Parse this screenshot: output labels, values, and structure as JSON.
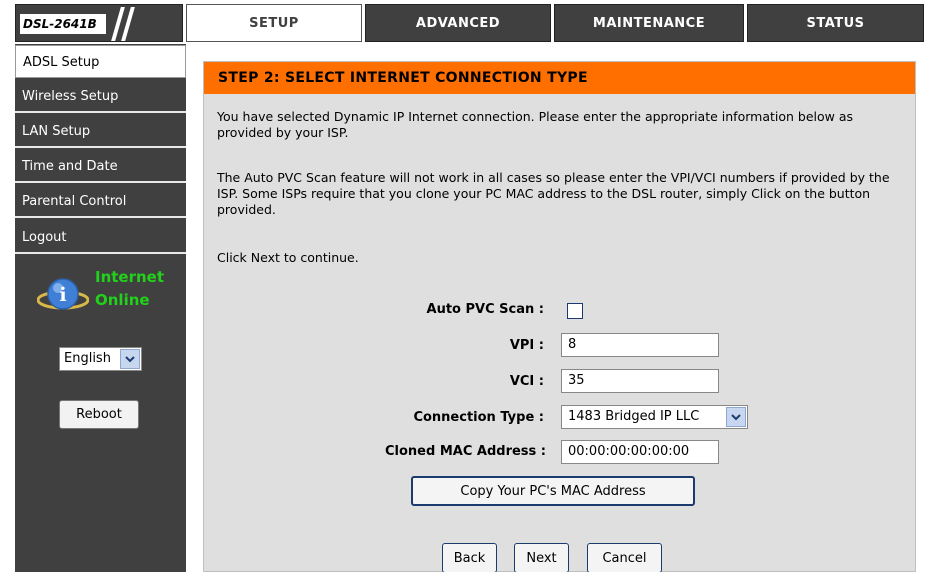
{
  "header": {
    "model": "DSL-2641B",
    "tabs": [
      {
        "label": "SETUP",
        "active": true
      },
      {
        "label": "ADVANCED",
        "active": false
      },
      {
        "label": "MAINTENANCE",
        "active": false
      },
      {
        "label": "STATUS",
        "active": false
      }
    ]
  },
  "sidebar": {
    "items": [
      {
        "label": "ADSL Setup",
        "active": true
      },
      {
        "label": "Wireless Setup",
        "active": false
      },
      {
        "label": "LAN Setup",
        "active": false
      },
      {
        "label": "Time and Date",
        "active": false
      },
      {
        "label": "Parental Control",
        "active": false
      },
      {
        "label": "Logout",
        "active": false
      }
    ],
    "status": {
      "line1": "Internet",
      "line2": "Online",
      "color": "#22d11a"
    },
    "language": "English",
    "reboot_label": "Reboot"
  },
  "main": {
    "title": "STEP 2: SELECT INTERNET CONNECTION TYPE",
    "para1": "You have selected Dynamic IP Internet connection. Please enter the appropriate information below as provided by your ISP.",
    "para2": "The Auto PVC Scan feature will not work in all cases so please enter the VPI/VCI numbers if provided by the ISP. Some ISPs require that you clone your PC MAC address to the DSL router, simply Click on the button provided.",
    "para3": "Click Next to continue.",
    "form": {
      "auto_pvc_label": "Auto PVC Scan :",
      "auto_pvc_checked": false,
      "vpi_label": "VPI :",
      "vpi_value": "8",
      "vci_label": "VCI :",
      "vci_value": "35",
      "conn_type_label": "Connection Type :",
      "conn_type_value": "1483 Bridged IP LLC",
      "mac_label": "Cloned MAC Address :",
      "mac_value": "00:00:00:00:00:00",
      "copy_mac_label": "Copy Your PC's MAC Address"
    },
    "buttons": {
      "back": "Back",
      "next": "Next",
      "cancel": "Cancel"
    }
  },
  "colors": {
    "accent": "#ff6f00",
    "nav_bg": "#404040",
    "panel_bg": "#dfdfdf"
  }
}
